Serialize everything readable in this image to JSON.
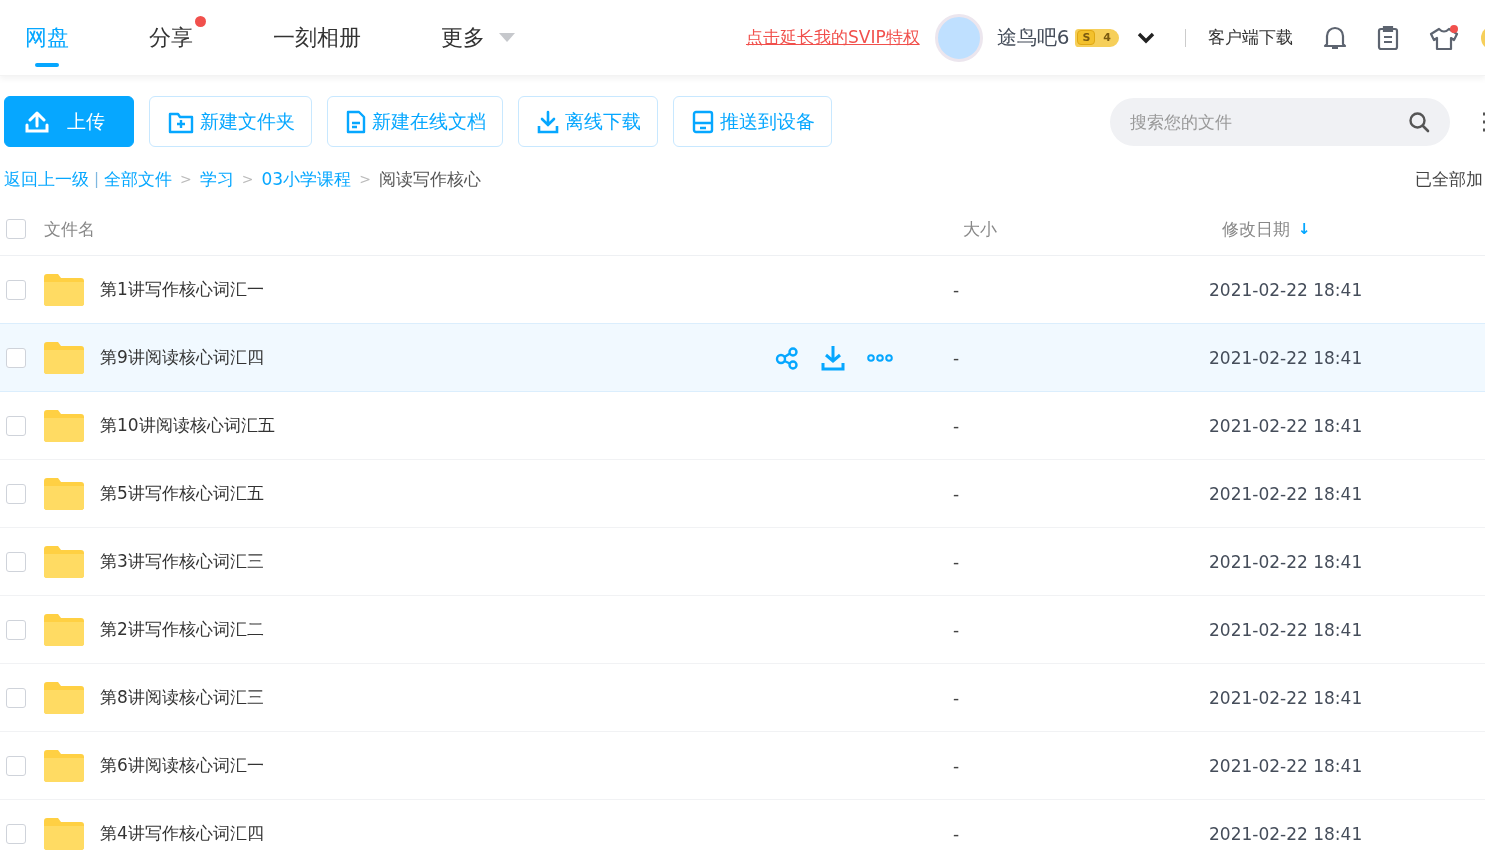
{
  "nav": {
    "tabs": [
      {
        "label": "网盘",
        "selected": true,
        "dot": false,
        "dropdown": false
      },
      {
        "label": "分享",
        "selected": false,
        "dot": true,
        "dropdown": false
      },
      {
        "label": "一刻相册",
        "selected": false,
        "dot": false,
        "dropdown": false
      },
      {
        "label": "更多",
        "selected": false,
        "dot": false,
        "dropdown": true
      }
    ],
    "promo_link": "点击延长我的SVIP特权",
    "user_name": "途鸟吧6",
    "vip_badge": {
      "letter": "S",
      "level": "4"
    },
    "client_download": "客户端下载",
    "notification_dot": true
  },
  "toolbar": {
    "buttons": [
      {
        "label": "上传",
        "kind": "upload",
        "primary": true
      },
      {
        "label": "新建文件夹",
        "kind": "folder",
        "primary": false
      },
      {
        "label": "新建在线文档",
        "kind": "doc",
        "primary": false
      },
      {
        "label": "离线下载",
        "kind": "download",
        "primary": false
      },
      {
        "label": "推送到设备",
        "kind": "device",
        "primary": false
      }
    ],
    "search": {
      "placeholder": "搜索您的文件"
    }
  },
  "breadcrumb": {
    "back": "返回上一级",
    "separator": "|",
    "items": [
      {
        "label": "全部文件"
      },
      {
        "label": "学习"
      },
      {
        "label": "03小学课程"
      },
      {
        "label": "阅读写作核心"
      }
    ],
    "arrow": ">",
    "status": "已全部加"
  },
  "table": {
    "all_checked": false,
    "columns": [
      "文件名",
      "大小",
      "修改日期"
    ],
    "sort_arrow": "↓",
    "rows": [
      {
        "name": "第1讲写作核心词汇一",
        "size": "-",
        "modified": "2021-02-22 18:41",
        "hovered": false,
        "checked": false
      },
      {
        "name": "第9讲阅读核心词汇四",
        "size": "-",
        "modified": "2021-02-22 18:41",
        "hovered": true,
        "checked": false
      },
      {
        "name": "第10讲阅读核心词汇五",
        "size": "-",
        "modified": "2021-02-22 18:41",
        "hovered": false,
        "checked": false
      },
      {
        "name": "第5讲写作核心词汇五",
        "size": "-",
        "modified": "2021-02-22 18:41",
        "hovered": false,
        "checked": false
      },
      {
        "name": "第3讲写作核心词汇三",
        "size": "-",
        "modified": "2021-02-22 18:41",
        "hovered": false,
        "checked": false
      },
      {
        "name": "第2讲写作核心词汇二",
        "size": "-",
        "modified": "2021-02-22 18:41",
        "hovered": false,
        "checked": false
      },
      {
        "name": "第8讲阅读核心词汇三",
        "size": "-",
        "modified": "2021-02-22 18:41",
        "hovered": false,
        "checked": false
      },
      {
        "name": "第6讲阅读核心词汇一",
        "size": "-",
        "modified": "2021-02-22 18:41",
        "hovered": false,
        "checked": false
      },
      {
        "name": "第4讲写作核心词汇四",
        "size": "-",
        "modified": "2021-02-22 18:41",
        "hovered": false,
        "checked": false
      }
    ]
  }
}
